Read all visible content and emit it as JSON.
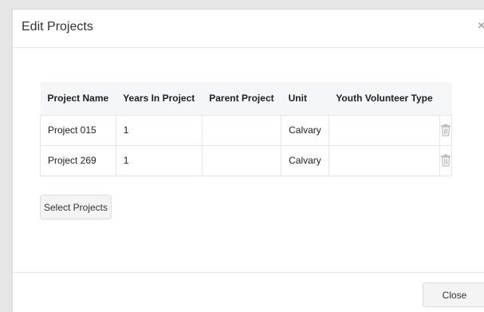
{
  "modal": {
    "title": "Edit Projects",
    "close_icon": "×"
  },
  "table": {
    "headers": [
      "Project Name",
      "Years In Project",
      "Parent Project",
      "Unit",
      "Youth Volunteer Type"
    ],
    "rows": [
      {
        "project_name": "Project 015",
        "years": "1",
        "parent": "",
        "unit": "Calvary",
        "type": ""
      },
      {
        "project_name": "Project 269",
        "years": "1",
        "parent": "",
        "unit": "Calvary",
        "type": ""
      }
    ],
    "row_action_icon": "trash-icon"
  },
  "buttons": {
    "select_projects": "Select Projects",
    "close": "Close"
  },
  "colors": {
    "header_bg": "#f5f6f8",
    "border": "#e6e6e6",
    "icon": "#bbbbbb"
  }
}
